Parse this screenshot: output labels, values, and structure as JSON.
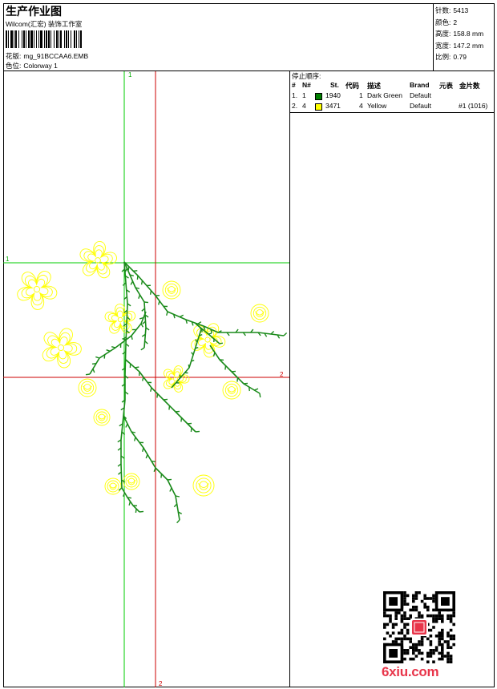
{
  "header": {
    "title": "生产作业图",
    "studio": "Wilcom(汇宏) 装饰工作室",
    "design_label": "花版:",
    "design_value": "mg_91BCCAA6.EMB",
    "colorway_label": "色位:",
    "colorway_value": "Colorway 1"
  },
  "stats": {
    "stitches_label": "针数:",
    "stitches_value": "5413",
    "colors_label": "颜色:",
    "colors_value": "2",
    "height_label": "高度:",
    "height_value": "158.8 mm",
    "width_label": "宽度:",
    "width_value": "147.2 mm",
    "scale_label": "比例:",
    "scale_value": "0.79"
  },
  "stop_sequence": {
    "title": "停止顺序:",
    "headers": [
      "#",
      "N#",
      "St.",
      "代码",
      "描述",
      "Brand",
      "元表",
      "金片数"
    ],
    "rows": [
      {
        "num": "1.",
        "n": "1",
        "color": "#008000",
        "code": "1940",
        "st": "1",
        "desc": "Dark Green",
        "brand": "Default",
        "spangle": ""
      },
      {
        "num": "2.",
        "n": "4",
        "color": "#ffff00",
        "code": "3471",
        "st": "4",
        "desc": "Yellow",
        "brand": "Default",
        "spangle": "#1 (1016)"
      }
    ]
  },
  "axes": {
    "top_label": "1",
    "left_label": "1",
    "right_label": "2",
    "bottom_label": "2"
  },
  "colors": {
    "green_axis": "#00cc00",
    "red_axis": "#cc0000",
    "stem": "#1a8a1a",
    "flower": "#ffff00",
    "brand_red": "#e8354a"
  },
  "watermark": "6xiu.com"
}
